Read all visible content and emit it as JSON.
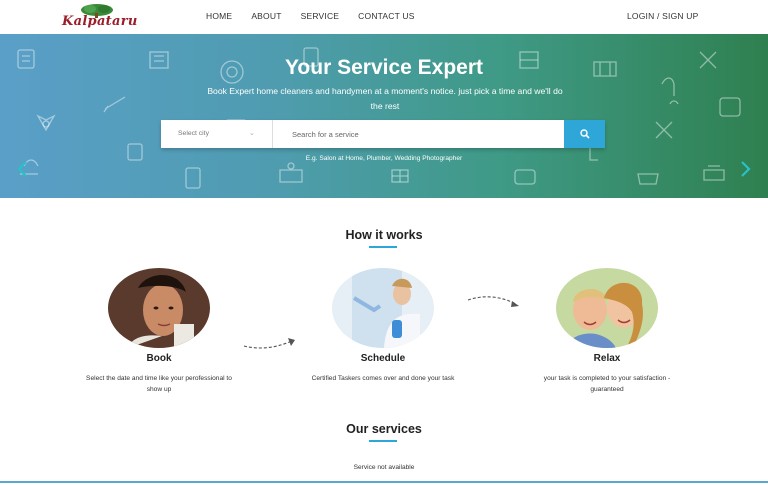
{
  "brand": {
    "name": "Kalpataru"
  },
  "nav": {
    "items": [
      "HOME",
      "ABOUT",
      "SERVICE",
      "CONTACT US"
    ],
    "login": "LOGIN / SIGN UP"
  },
  "hero": {
    "title": "Your Service Expert",
    "subtitle": "Book Expert home cleaners and handymen at a moment's notice. just pick a time and we'll do the rest",
    "city_select": "Select city",
    "search_placeholder": "Search for a service",
    "hint": "E.g. Salon at Home, Plumber, Wedding Photographer"
  },
  "how_it_works": {
    "title": "How it works",
    "steps": [
      {
        "title": "Book",
        "desc": "Select the date and time like your perofessional to show up"
      },
      {
        "title": "Schedule",
        "desc": "Certified Taskers comes over and done your task"
      },
      {
        "title": "Relax",
        "desc": "your task is completed to your satisfaction - guaranteed"
      }
    ]
  },
  "services": {
    "title": "Our services",
    "empty": "Service not available"
  },
  "colors": {
    "accent": "#2ea7d8",
    "brand": "#9b1d2a",
    "hero_left": "#5a9fc8",
    "hero_right": "#2f8050"
  },
  "icons": [
    "logo-tree-icon",
    "search-icon",
    "chevron-left-icon",
    "chevron-right-icon"
  ]
}
